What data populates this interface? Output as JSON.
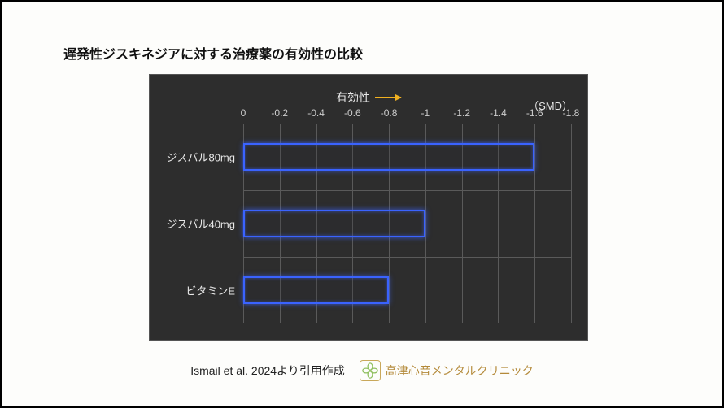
{
  "title": "遅発性ジスキネジアに対する治療薬の有効性の比較",
  "axis_title": "有効性",
  "unit_label": "（SMD）",
  "ticks": [
    "0",
    "-0.2",
    "-0.4",
    "-0.6",
    "-0.8",
    "-1",
    "-1.2",
    "-1.4",
    "-1.6",
    "-1.8"
  ],
  "footer_citation": "Ismail et al. 2024より引用作成",
  "clinic_name": "高津心音メンタルクリニック",
  "chart_data": {
    "type": "bar",
    "orientation": "horizontal",
    "categories": [
      "ジスバル80mg",
      "ジスバル40mg",
      "ビタミンE"
    ],
    "values": [
      -1.6,
      -1.0,
      -0.8
    ],
    "xlabel": "有効性",
    "ylabel": "",
    "xlim": [
      0,
      -1.8
    ],
    "title": "遅発性ジスキネジアに対する治療薬の有効性の比較",
    "unit": "SMD"
  }
}
